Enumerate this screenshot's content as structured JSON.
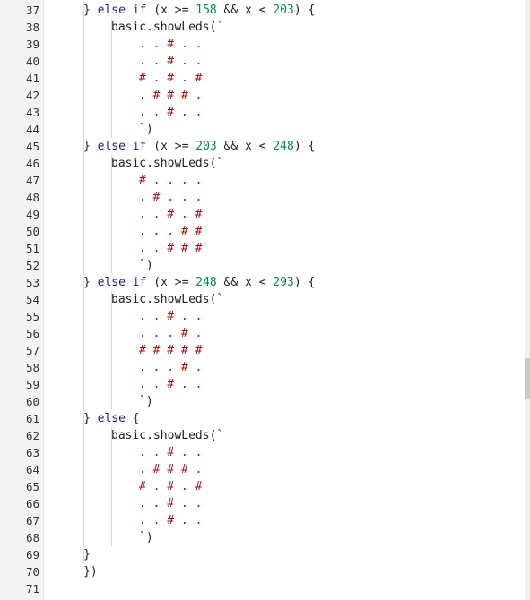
{
  "editor": {
    "lines": [
      {
        "n": "37",
        "tokens": [
          [
            "p",
            "} "
          ],
          [
            "kw",
            "else if"
          ],
          [
            "p",
            " (x >= "
          ],
          [
            "num",
            "158"
          ],
          [
            "p",
            " && x < "
          ],
          [
            "num",
            "203"
          ],
          [
            "p",
            ") {"
          ]
        ]
      },
      {
        "n": "38",
        "tokens": [
          [
            "p",
            "basic.showLeds(`"
          ]
        ]
      },
      {
        "n": "39",
        "tokens": [
          [
            "str",
            ". . # . ."
          ]
        ]
      },
      {
        "n": "40",
        "tokens": [
          [
            "str",
            ". . # . ."
          ]
        ]
      },
      {
        "n": "41",
        "tokens": [
          [
            "str",
            "# . # . #"
          ]
        ]
      },
      {
        "n": "42",
        "tokens": [
          [
            "str",
            ". # # # ."
          ]
        ]
      },
      {
        "n": "43",
        "tokens": [
          [
            "str",
            ". . # . ."
          ]
        ]
      },
      {
        "n": "44",
        "tokens": [
          [
            "p",
            "`)"
          ]
        ]
      },
      {
        "n": "45",
        "tokens": [
          [
            "p",
            "} "
          ],
          [
            "kw",
            "else if"
          ],
          [
            "p",
            " (x >= "
          ],
          [
            "num",
            "203"
          ],
          [
            "p",
            " && x < "
          ],
          [
            "num",
            "248"
          ],
          [
            "p",
            ") {"
          ]
        ]
      },
      {
        "n": "46",
        "tokens": [
          [
            "p",
            "basic.showLeds(`"
          ]
        ]
      },
      {
        "n": "47",
        "tokens": [
          [
            "str",
            "# . . . ."
          ]
        ]
      },
      {
        "n": "48",
        "tokens": [
          [
            "str",
            ". # . . ."
          ]
        ]
      },
      {
        "n": "49",
        "tokens": [
          [
            "str",
            ". . # . #"
          ]
        ]
      },
      {
        "n": "50",
        "tokens": [
          [
            "str",
            ". . . # #"
          ]
        ]
      },
      {
        "n": "51",
        "tokens": [
          [
            "str",
            ". . # # #"
          ]
        ]
      },
      {
        "n": "52",
        "tokens": [
          [
            "p",
            "`)"
          ]
        ]
      },
      {
        "n": "53",
        "tokens": [
          [
            "p",
            "} "
          ],
          [
            "kw",
            "else if"
          ],
          [
            "p",
            " (x >= "
          ],
          [
            "num",
            "248"
          ],
          [
            "p",
            " && x < "
          ],
          [
            "num",
            "293"
          ],
          [
            "p",
            ") {"
          ]
        ]
      },
      {
        "n": "54",
        "tokens": [
          [
            "p",
            "basic.showLeds(`"
          ]
        ]
      },
      {
        "n": "55",
        "tokens": [
          [
            "str",
            ". . # . ."
          ]
        ]
      },
      {
        "n": "56",
        "tokens": [
          [
            "str",
            ". . . # ."
          ]
        ]
      },
      {
        "n": "57",
        "tokens": [
          [
            "str",
            "# # # # #"
          ]
        ]
      },
      {
        "n": "58",
        "tokens": [
          [
            "str",
            ". . . # ."
          ]
        ]
      },
      {
        "n": "59",
        "tokens": [
          [
            "str",
            ". . # . ."
          ]
        ]
      },
      {
        "n": "60",
        "tokens": [
          [
            "p",
            "`)"
          ]
        ]
      },
      {
        "n": "61",
        "tokens": [
          [
            "p",
            "} "
          ],
          [
            "kw",
            "else"
          ],
          [
            "p",
            " {"
          ]
        ]
      },
      {
        "n": "62",
        "tokens": [
          [
            "p",
            "basic.showLeds(`"
          ]
        ]
      },
      {
        "n": "63",
        "tokens": [
          [
            "str",
            ". . # . ."
          ]
        ]
      },
      {
        "n": "64",
        "tokens": [
          [
            "str",
            ". # # # ."
          ]
        ]
      },
      {
        "n": "65",
        "tokens": [
          [
            "str",
            "# . # . #"
          ]
        ]
      },
      {
        "n": "66",
        "tokens": [
          [
            "str",
            ". . # . ."
          ]
        ]
      },
      {
        "n": "67",
        "tokens": [
          [
            "str",
            ". . # . ."
          ]
        ]
      },
      {
        "n": "68",
        "tokens": [
          [
            "p",
            "`)"
          ]
        ]
      },
      {
        "n": "69",
        "tokens": [
          [
            "p",
            "}"
          ]
        ]
      },
      {
        "n": "70",
        "tokens": [
          [
            "p",
            "})"
          ]
        ]
      },
      {
        "n": "71",
        "tokens": []
      }
    ]
  },
  "colors": {
    "keyword": "#1a1aa6",
    "number": "#098658",
    "string": "#a31515",
    "plain": "#222222",
    "gutter_bg": "#f3f3f3"
  }
}
